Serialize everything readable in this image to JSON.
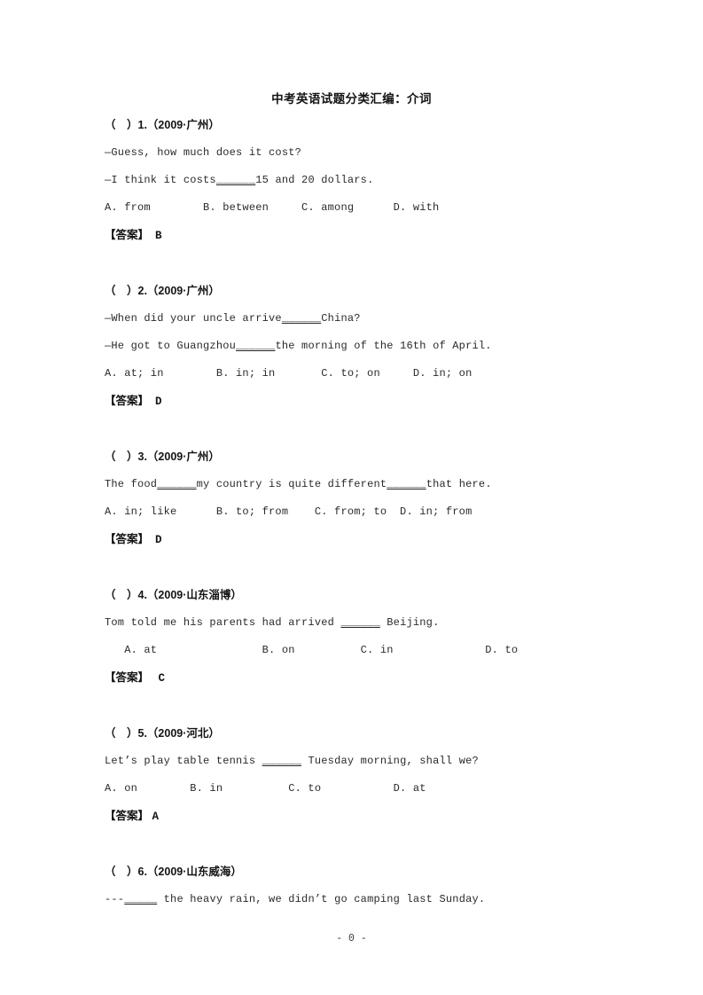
{
  "document": {
    "title": "中考英语试题分类汇编：介词",
    "footer": "- 0 -"
  },
  "labels": {
    "answer_prefix": "【答案】"
  },
  "questions": [
    {
      "header": "（　）1.（2009·广州）",
      "lines": [
        "—Guess, how much does it cost?",
        "—I think it costs"
      ],
      "line2_before": "—I think it costs",
      "line2_blank": "______",
      "line2_after": "15 and 20 dollars.",
      "options": "A. from        B. between     C. among      D. with",
      "answer": "B"
    },
    {
      "header": "（　）2.（2009·广州）",
      "line1_before": "—When did your uncle arrive",
      "line1_blank": "______",
      "line1_after": "China?",
      "line2_before": "—He got to Guangzhou",
      "line2_blank": "______",
      "line2_after": "the morning of the 16th of April.",
      "options": "A. at; in        B. in; in       C. to; on     D. in; on",
      "answer": "D"
    },
    {
      "header": "（　）3.（2009·广州）",
      "line1_before": "The food",
      "line1_blank": "______",
      "line1_mid": "my country is quite different",
      "line1_blank2": "______",
      "line1_after": "that here.",
      "options": "A. in; like      B. to; from    C. from; to  D. in; from",
      "answer": "D"
    },
    {
      "header": "（　）4.（2009·山东淄博）",
      "line1_before": "Tom told me his parents had arrived ",
      "line1_blank": "______",
      "line1_after": " Beijing.",
      "options": "   A. at                B. on          C. in              D. to",
      "answer": "C"
    },
    {
      "header": "（　）5.（2009·河北）",
      "line1_before": "Let’s play table tennis ",
      "line1_blank": "______",
      "line1_after": " Tuesday morning, shall we?",
      "options": "A. on        B. in          C. to           D. at",
      "answer": "A"
    },
    {
      "header": "（　）6.（2009·山东威海）",
      "line1_before": "---",
      "line1_blank": "_____",
      "line1_after": " the heavy rain, we didn’t go camping last Sunday."
    }
  ]
}
